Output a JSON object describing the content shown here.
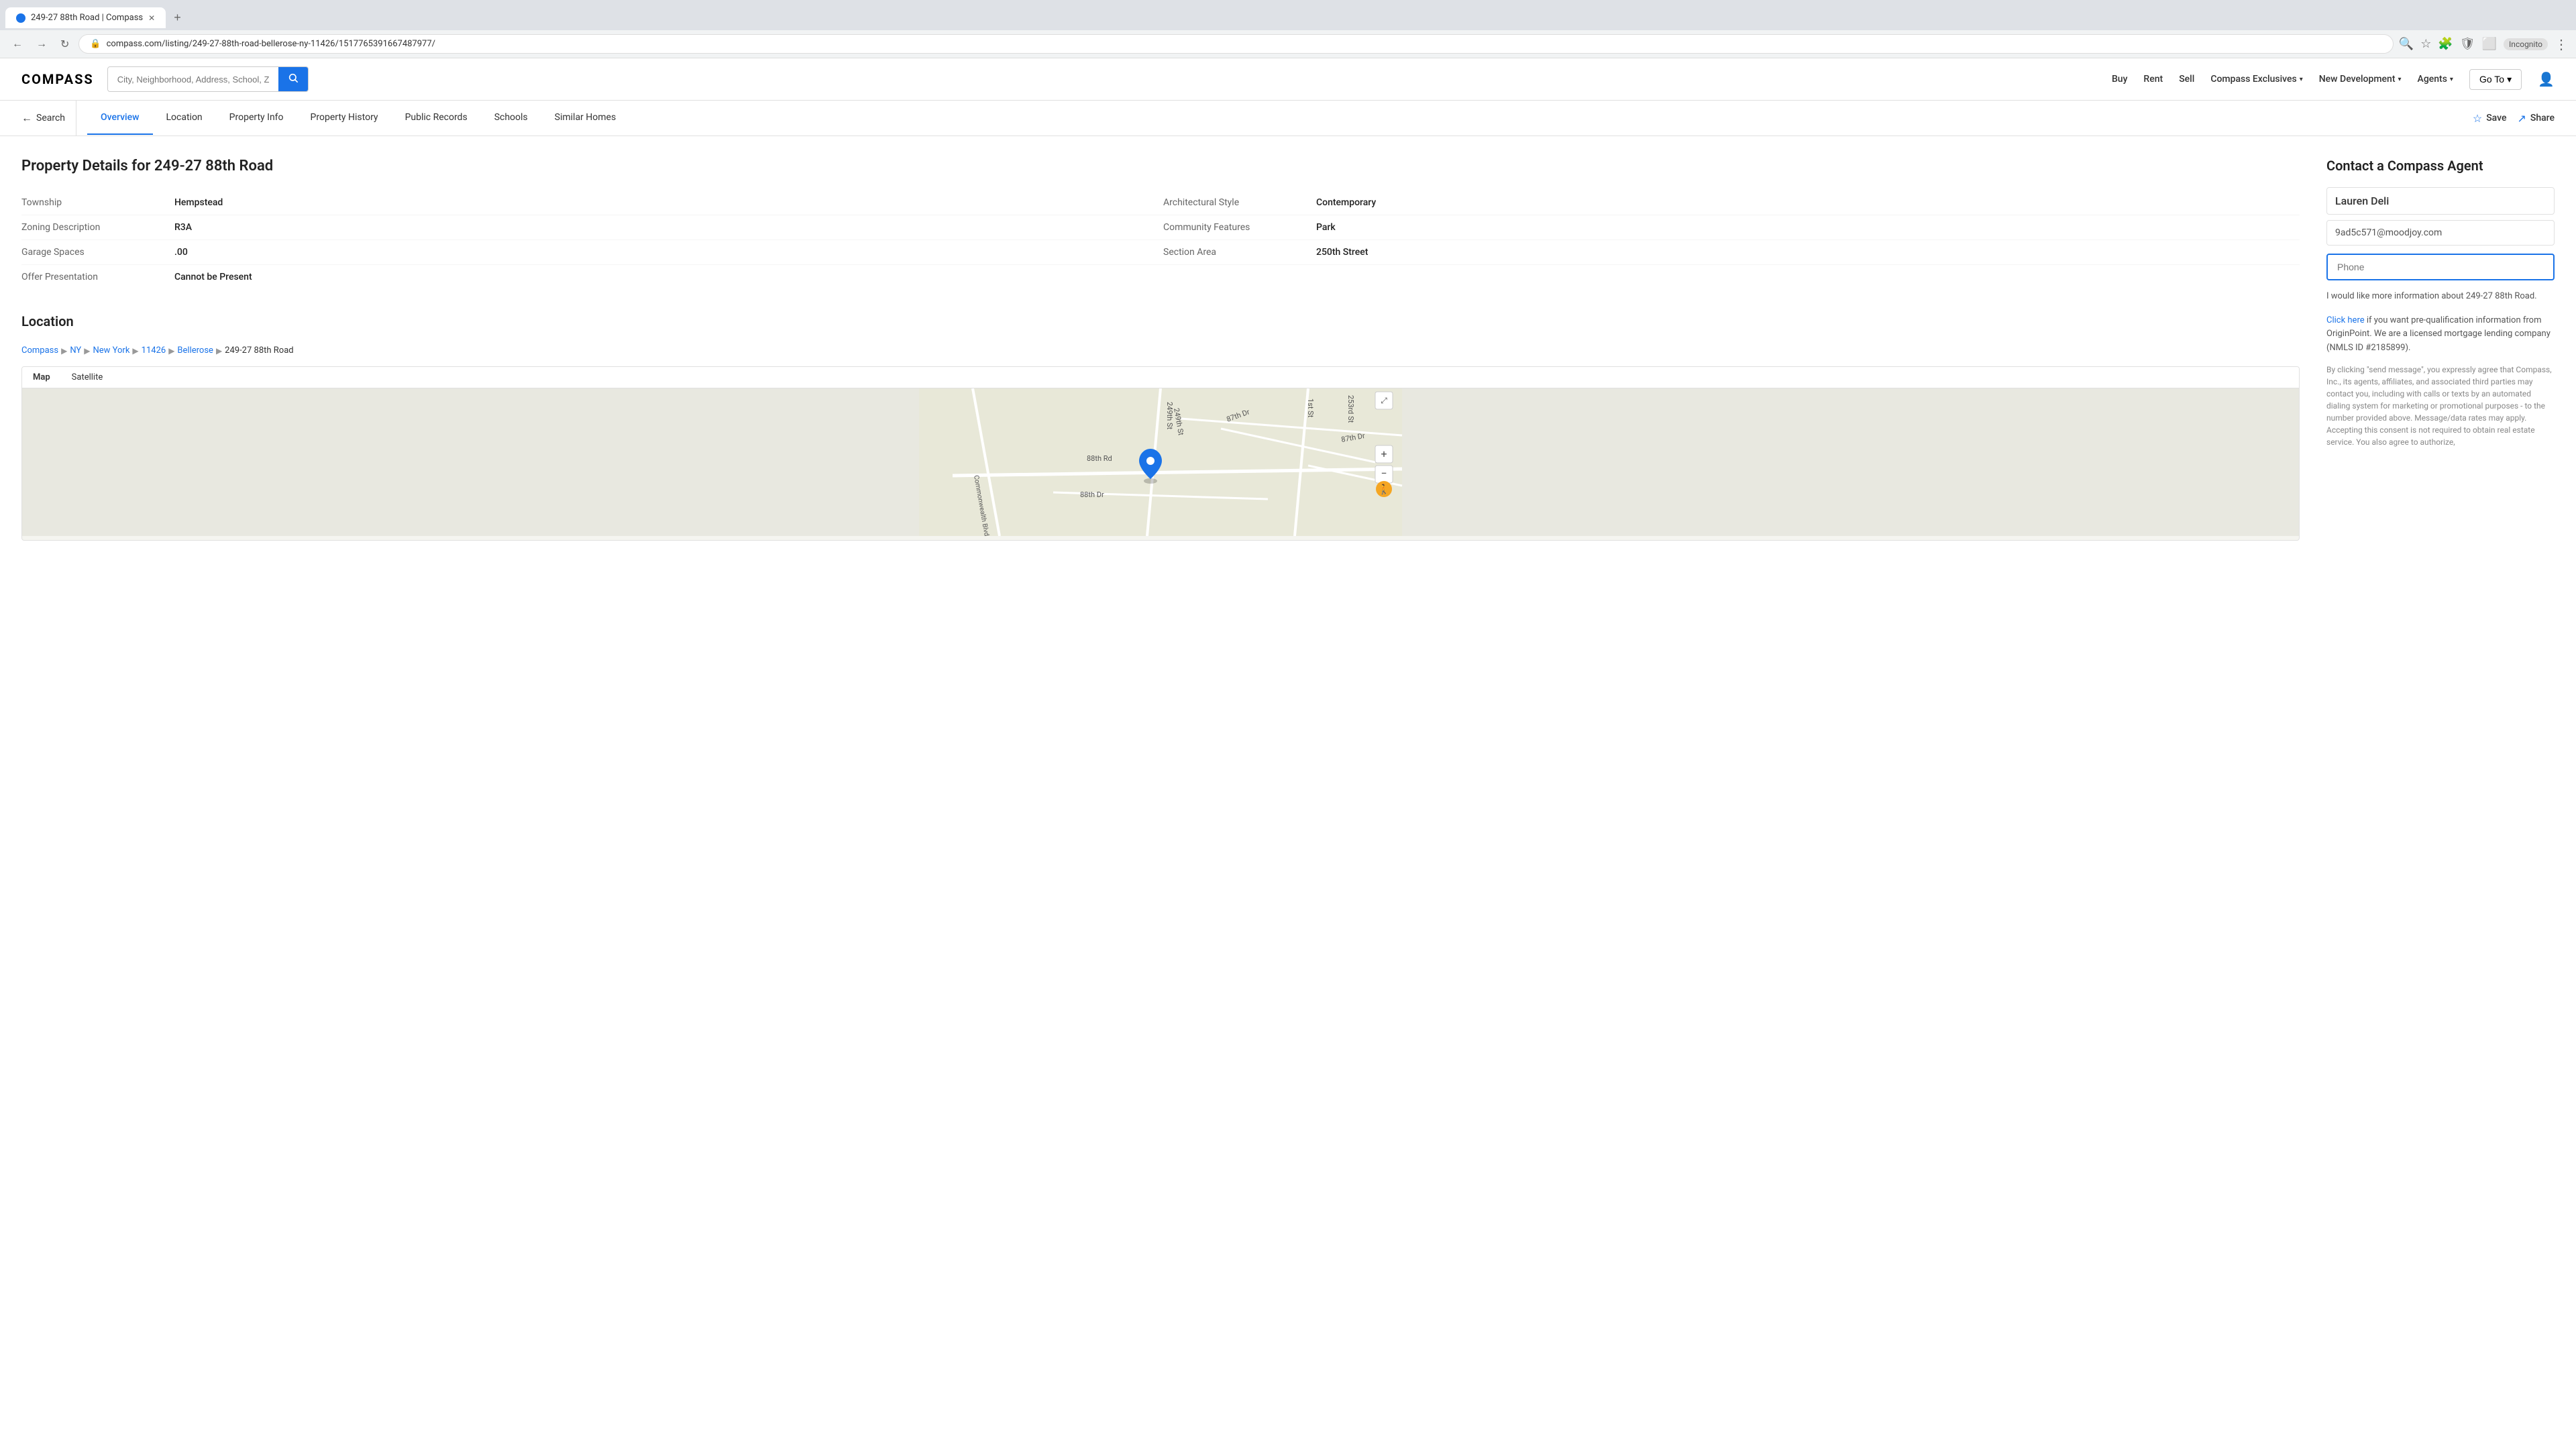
{
  "browser": {
    "tab_title": "249-27 88th Road | Compass",
    "url": "compass.com/listing/249-27-88th-road-bellerose-ny-11426/1517765391667487977/",
    "incognito_label": "Incognito"
  },
  "header": {
    "logo": "COMPASS",
    "search_placeholder": "City, Neighborhood, Address, School, ZIP, Agent, ID",
    "nav_buy": "Buy",
    "nav_rent": "Rent",
    "nav_sell": "Sell",
    "nav_exclusives": "Compass Exclusives",
    "nav_new_dev": "New Development",
    "nav_agents": "Agents",
    "nav_goto": "Go To"
  },
  "sub_nav": {
    "back_label": "Search",
    "tabs": [
      "Overview",
      "Location",
      "Property Info",
      "Property History",
      "Public Records",
      "Schools",
      "Similar Homes"
    ],
    "active_tab": "Overview",
    "save_label": "Save",
    "share_label": "Share"
  },
  "property": {
    "title": "Property Details for 249-27 88th Road",
    "details": [
      {
        "label": "Township",
        "value": "Hempstead",
        "label2": "Architectural Style",
        "value2": "Contemporary"
      },
      {
        "label": "Zoning Description",
        "value": "R3A",
        "label2": "Community Features",
        "value2": "Park"
      },
      {
        "label": "Garage Spaces",
        "value": ".00",
        "label2": "Section Area",
        "value2": "250th Street"
      },
      {
        "label": "Offer Presentation",
        "value": "Cannot be Present",
        "label2": "",
        "value2": ""
      }
    ]
  },
  "location": {
    "title": "Location",
    "breadcrumb": [
      "Compass",
      "NY",
      "New York",
      "11426",
      "Bellerose",
      "249-27 88th Road"
    ]
  },
  "map": {
    "tab_map": "Map",
    "tab_satellite": "Satellite"
  },
  "contact": {
    "title": "Contact a Compass Agent",
    "agent_name": "Lauren Deli",
    "agent_email": "9ad5c571@moodjoy.com",
    "phone_placeholder": "Phone",
    "message": "I would like more information about 249-27 88th Road.",
    "mortgage_text": "Click here if you want pre-qualification information from OriginPoint. We are a licensed mortgage lending company (NMLS ID #2185899).",
    "disclaimer": "By clicking \"send message\", you expressly agree that Compass, Inc., its agents, affiliates, and associated third parties may contact you, including with calls or texts by an automated dialing system for marketing or promotional purposes - to the number provided above. Message/data rates may apply. Accepting this consent is not required to obtain real estate service. You also agree to authorize,"
  }
}
